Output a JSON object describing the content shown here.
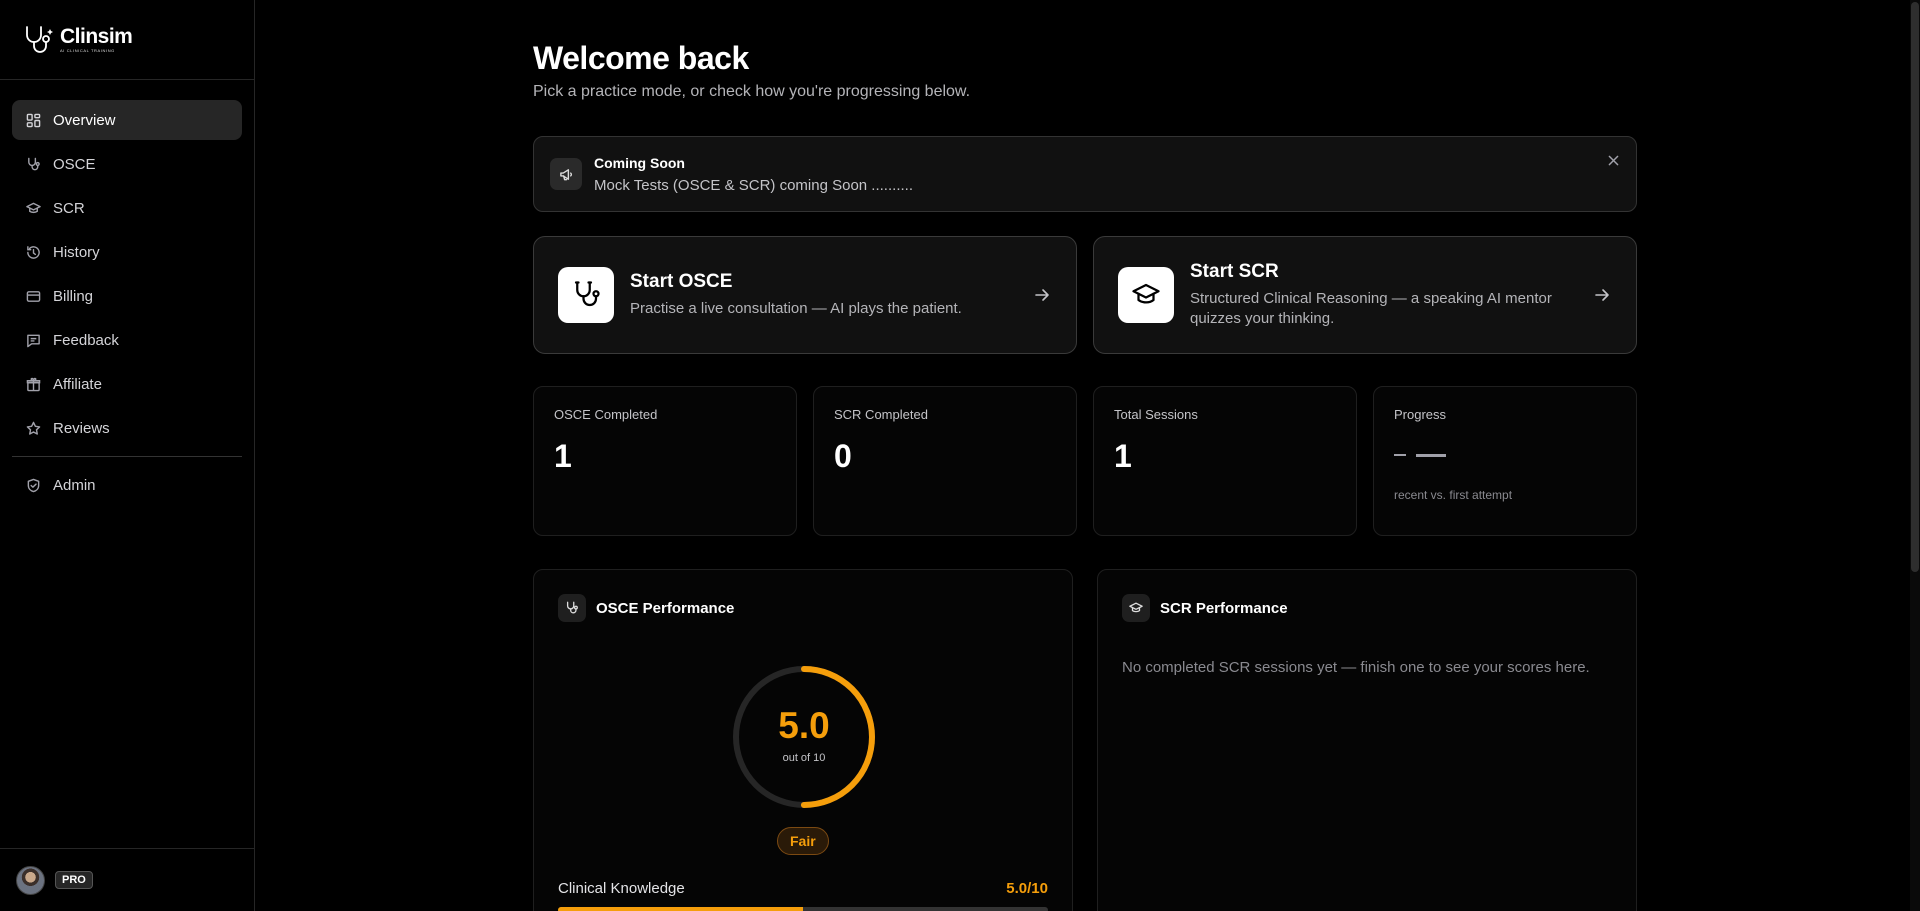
{
  "brand": {
    "name": "Clinsim",
    "tagline": "AI CLINICAL TRAINING"
  },
  "sidebar": {
    "items": [
      {
        "label": "Overview",
        "icon": "grid-icon",
        "active": true
      },
      {
        "label": "OSCE",
        "icon": "stethoscope-icon"
      },
      {
        "label": "SCR",
        "icon": "graduation-cap-icon"
      },
      {
        "label": "History",
        "icon": "history-icon"
      },
      {
        "label": "Billing",
        "icon": "wallet-icon"
      },
      {
        "label": "Feedback",
        "icon": "message-icon"
      },
      {
        "label": "Affiliate",
        "icon": "gift-icon"
      },
      {
        "label": "Reviews",
        "icon": "star-icon"
      }
    ],
    "admin": {
      "label": "Admin",
      "icon": "shield-icon"
    },
    "plan_badge": "PRO"
  },
  "header": {
    "title": "Welcome back",
    "subtitle": "Pick a practice mode, or check how you're progressing below."
  },
  "banner": {
    "title": "Coming Soon",
    "message": "Mock Tests (OSCE & SCR) coming Soon ..........",
    "icon": "megaphone-icon"
  },
  "start_cards": {
    "osce": {
      "title": "Start OSCE",
      "description": "Practise a live consultation — AI plays the patient."
    },
    "scr": {
      "title": "Start SCR",
      "description": "Structured Clinical Reasoning — a speaking AI mentor quizzes your thinking."
    }
  },
  "stats": {
    "osce_completed": {
      "label": "OSCE Completed",
      "value": "1"
    },
    "scr_completed": {
      "label": "SCR Completed",
      "value": "0"
    },
    "total_sessions": {
      "label": "Total Sessions",
      "value": "1"
    },
    "progress": {
      "label": "Progress",
      "note": "recent vs. first attempt"
    }
  },
  "osce_performance": {
    "title": "OSCE Performance",
    "score": "5.0",
    "score_fraction": 0.5,
    "score_sub": "out of 10",
    "rating": "Fair",
    "metrics": [
      {
        "label": "Clinical Knowledge",
        "score": "5.0/10",
        "fraction": 0.5
      }
    ]
  },
  "scr_performance": {
    "title": "SCR Performance",
    "empty_message": "No completed SCR sessions yet — finish one to see your scores here."
  },
  "colors": {
    "accent": "#f59e0b",
    "background": "#000000",
    "card": "#111111"
  }
}
